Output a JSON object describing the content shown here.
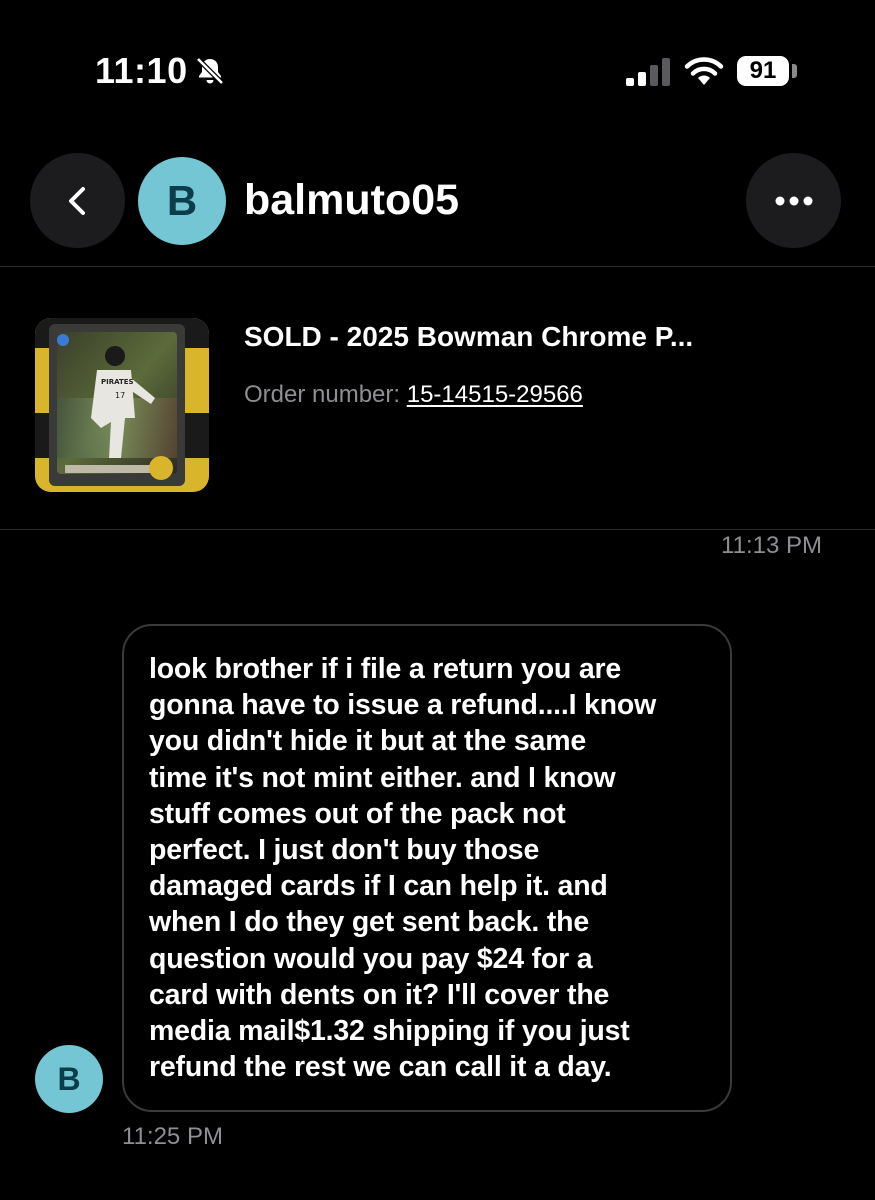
{
  "status_bar": {
    "time": "11:10",
    "battery": "91",
    "icons": [
      "bell-slash-icon",
      "signal-icon",
      "wifi-icon",
      "battery-icon"
    ]
  },
  "header": {
    "avatar_initial": "B",
    "username": "balmuto05",
    "icons": [
      "chevron-left-icon",
      "more-icon"
    ]
  },
  "order": {
    "title": "SOLD - 2025 Bowman Chrome P...",
    "number_label": "Order number:",
    "number_value": "15-14515-29566",
    "timestamp": "11:13 PM"
  },
  "message": {
    "avatar_initial": "B",
    "text": "look brother if i file a return you are\ngonna have to issue a refund....I know\nyou didn't hide it but at the same\ntime it's not mint either. and I know\nstuff comes out of the pack not\nperfect. I just don't buy those\ndamaged cards if I can help it. and\nwhen I do they get sent back. the\nquestion would you pay $24 for a\ncard with dents on it? I'll cover the\nmedia mail$1.32 shipping if you just\nrefund the rest we can call it a day.",
    "timestamp": "11:25 PM"
  },
  "colors": {
    "background": "#000000",
    "avatar": "#74c6d4",
    "secondary_text": "#8e8e93",
    "bubble_border": "#3a3a3c"
  }
}
